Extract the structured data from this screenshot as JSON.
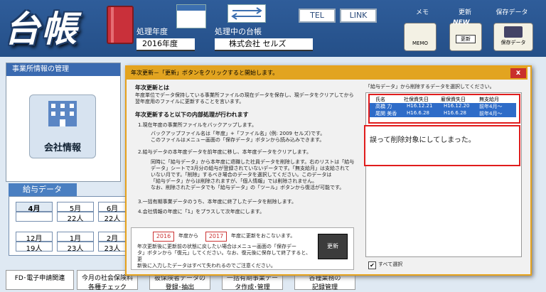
{
  "header": {
    "logo": "台帳",
    "fiscal_label": "処理年度",
    "fiscal_value": "2016年度",
    "company_label": "処理中の台帳",
    "company_value": "株式会社 セルズ",
    "tel_label": "TEL",
    "link_label": "LINK",
    "memo_caption": "メモ",
    "update_caption": "更新",
    "save_caption": "保存データ",
    "memo_icon_text": "MEMO",
    "update_icon_text": "更新",
    "update_new_badge": "NEW",
    "save_icon_text": "保存データ"
  },
  "left_panel": {
    "title": "事業所情報の管理",
    "company_button": "会社情報"
  },
  "salary": {
    "tab": "給与データ",
    "row1": [
      "4月",
      "5月",
      "6月"
    ],
    "row1_counts": [
      "",
      "22人",
      "22人"
    ],
    "row2": [
      "12月",
      "1月",
      "2月"
    ],
    "row2_counts": [
      "19人",
      "23人",
      "23人"
    ]
  },
  "bottom_buttons": [
    {
      "line1": "FD･電子申請関連",
      "line2": ""
    },
    {
      "line1": "今月の社会保険料",
      "line2": "各種チェック"
    },
    {
      "line1": "被保険者データの",
      "line2": "登録･抽出"
    },
    {
      "line1": "一括有期事業デー",
      "line2": "タ作成･管理"
    },
    {
      "line1": "各種業務の",
      "line2": "記録管理"
    }
  ],
  "dialog": {
    "title": "年次更新－「更新」ボタンをクリックすると開始します。",
    "close": "x",
    "h1": "年次更新とは",
    "p1a": "年度単位でデータ保持している事業所ファイルの現在データを保存し、現データをクリアしてから",
    "p1b": "翌年度用のファイルに更新することを言います。",
    "h2": "年次更新すると以下の内部処理が行われます",
    "s1": "1.現在年度の事業所ファイルをバックアップします。",
    "s1a": "バックアップファイル名は「年度」+「ファイル名」(例: 2009 セルズ)です。",
    "s1b": "このファイルはメニュー画面の「保存データ」ボタンから読み込みできます。",
    "s2": "2.給与データの本年度データを前年度に移し、本年度データをクリアします。",
    "s2a": "同時に「給与データ」から本年度に退職した社員データを削除します。右のリストは「給与",
    "s2b": "データ」シートで3月分の給与が登録されていないデータです。「無支給月」は支給されて",
    "s2c": "いない月です。「削除」するべき場合のデータを選択してください。このデータは",
    "s2d": "「給与データ」からは削除されますが、「個人情報」では削除されません。",
    "s2e": "なお、削除されたデータでも「給与データ」の「ツール」ボタンから復活が可能です。",
    "s3": "3.一括有期事業データのうち、本年度に終了したデータを削除します。",
    "s4": "4.会社情報の年度に「1」をプラスして次年度にします。",
    "year_from": "2016",
    "year_from_suffix": "年度から",
    "year_to": "2017",
    "year_to_suffix": "年度に更新をおこないます。",
    "note1": "年次更新後に更新前の状態に戻したい場合はメニュー画面の「保存デー",
    "note2": "タ」ボタンから「復元」してください。なお、復元後に保存して終了すると、更",
    "note3": "新後に入力したデータはすべて失われるのでご注意ください。",
    "update_button": "更新",
    "right_title": "「給与データ」から削除するデータを選択してください。",
    "columns": [
      "氏名",
      "社保資失日",
      "雇保資失日",
      "無支給月"
    ],
    "rows": [
      [
        "高橋 力",
        "H16.12.21",
        "H16.12.20",
        "前年4月～"
      ],
      [
        "尾関 美香",
        "H16.6.28",
        "H16.6.28",
        "前年4月～"
      ]
    ],
    "annotation": "誤って削除対象にしてしまった。",
    "select_all": "すべて選択"
  }
}
